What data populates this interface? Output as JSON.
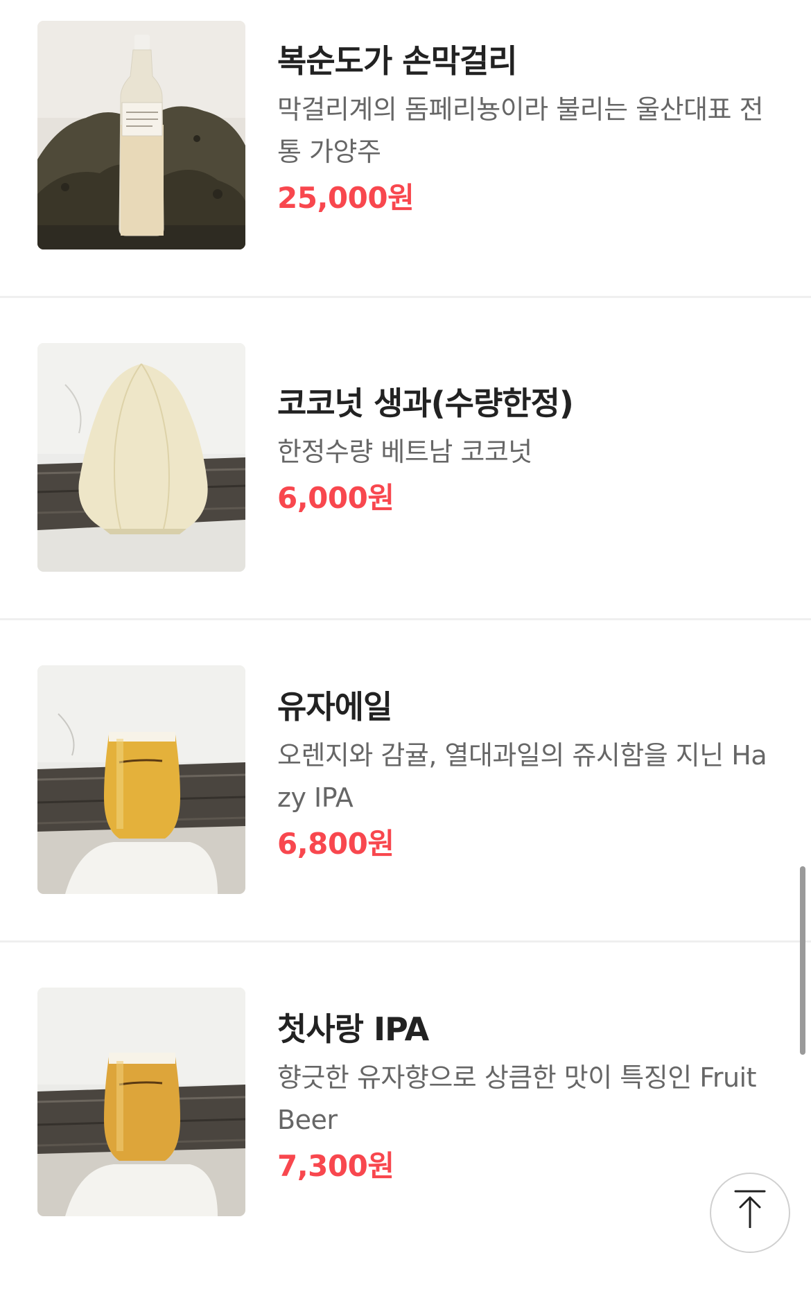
{
  "menu": {
    "items": [
      {
        "name": "복순도가 손막걸리",
        "description": "막걸리계의 돔페리뇽이라 불리는 울산대표 전통 가양주",
        "price": "25,000원",
        "image_icon": "makgeolli-bottle-photo"
      },
      {
        "name": "코코넛 생과(수량한정)",
        "description": "한정수량 베트남 코코넛",
        "price": "6,000원",
        "image_icon": "coconut-photo"
      },
      {
        "name": "유자에일",
        "description": "오렌지와 감귤, 열대과일의 쥬시함을 지닌 Hazy IPA",
        "price": "6,800원",
        "image_icon": "beer-glass-photo"
      },
      {
        "name": "첫사랑 IPA",
        "description": "향긋한 유자향으로 상큼한 맛이 특징인 Fruit Beer",
        "price": "7,300원",
        "image_icon": "beer-glass-photo"
      }
    ]
  },
  "top_button": {
    "icon": "arrow-up-to-top-icon"
  },
  "colors": {
    "price": "#f8474e",
    "title": "#222222",
    "description": "#666666",
    "divider": "#efefef"
  }
}
